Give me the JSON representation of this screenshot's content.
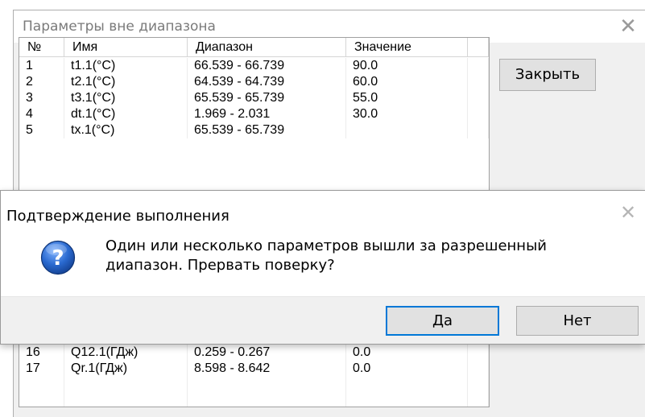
{
  "background_window": {
    "title": "Параметры вне диапазона",
    "close_glyph": "✕",
    "close_button_label": "Закрыть",
    "columns": [
      "№",
      "Имя",
      "Диапазон",
      "Значение",
      ""
    ],
    "rows_visible_top": [
      {
        "n": "1",
        "name": "t1.1(°C)",
        "range": "66.539 - 66.739",
        "value": "90.0"
      },
      {
        "n": "2",
        "name": "t2.1(°C)",
        "range": "64.539 - 64.739",
        "value": "60.0"
      },
      {
        "n": "3",
        "name": "t3.1(°C)",
        "range": "65.539 - 65.739",
        "value": "55.0"
      },
      {
        "n": "4",
        "name": "dt.1(°C)",
        "range": "1.969 - 2.031",
        "value": "30.0"
      },
      {
        "n": "5",
        "name": "tх.1(°C)",
        "range": "65.539 - 65.739",
        "value": ""
      }
    ],
    "rows_visible_bottom": [
      {
        "n": "16",
        "name": "Q12.1(ГДж)",
        "range": "0.259 - 0.267",
        "value": "0.0"
      },
      {
        "n": "17",
        "name": "Qr.1(ГДж)",
        "range": "8.598 - 8.642",
        "value": "0.0"
      }
    ]
  },
  "dialog": {
    "title": "Подтверждение выполнения",
    "close_glyph": "✕",
    "icon": "question-icon",
    "message_line1": "Один или несколько параметров вышли за разрешенный",
    "message_line2": "диапазон. Прервать поверку?",
    "yes_label": "Да",
    "no_label": "Нет"
  },
  "colors": {
    "accent": "#0078d7",
    "icon_blue": "#1f5fb8"
  }
}
